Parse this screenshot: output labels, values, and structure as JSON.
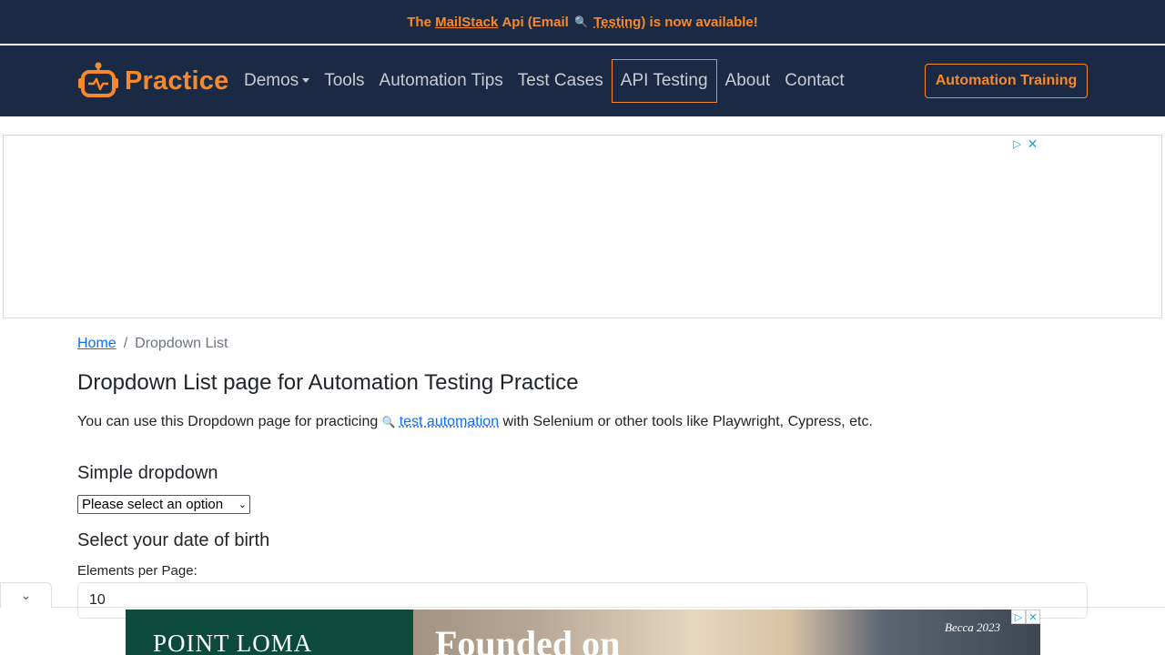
{
  "announcement": {
    "prefix": "The",
    "link_text": "MailStack",
    "middle": "Api (Email",
    "search_glyph": "🔍",
    "link2_text": "Testing",
    "suffix": ") is now available!"
  },
  "navbar": {
    "brand": "Practice",
    "links": [
      {
        "label": "Demos",
        "dropdown": true
      },
      {
        "label": "Tools"
      },
      {
        "label": "Automation Tips"
      },
      {
        "label": "Test Cases"
      },
      {
        "label": "API Testing",
        "active": true
      },
      {
        "label": "About"
      },
      {
        "label": "Contact"
      }
    ],
    "cta_label": "Automation Training"
  },
  "ad_top": {
    "icons": [
      "adchoices-icon",
      "close-icon"
    ]
  },
  "breadcrumb": {
    "home": "Home",
    "separator": "/",
    "current": "Dropdown List"
  },
  "main": {
    "title": "Dropdown List page for Automation Testing Practice",
    "intro_before": "You can use this Dropdown page for practicing",
    "intro_link": "test automation",
    "intro_after": "with Selenium or other tools like Playwright, Cypress, etc.",
    "simple_heading": "Simple dropdown",
    "simple_selected": "Please select an option",
    "dob_heading": "Select your date of birth",
    "epp_label": "Elements per Page:",
    "epp_value": "10"
  },
  "ad_bottom": {
    "brand": "POINT LOMA",
    "headline": "Founded on",
    "signature": "Becca 2023"
  },
  "colors": {
    "navy": "#1b2a44",
    "accent": "#f7892b",
    "link": "#0d6efd"
  }
}
